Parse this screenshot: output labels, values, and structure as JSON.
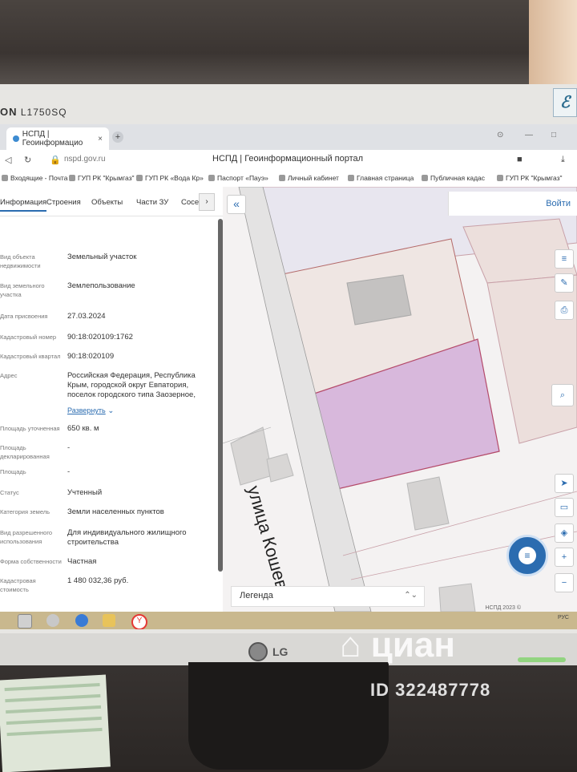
{
  "monitor": {
    "model_top": "L1750SQ",
    "brand_prefix": "ON",
    "bottom_brand": "LG"
  },
  "browser": {
    "tab_title": "НСПД | Геоинформацио",
    "tab_close": "×",
    "new_tab": "+",
    "url": "nspd.gov.ru",
    "page_title": "НСПД | Геоинформационный портал",
    "bookmarks": [
      "Входящие - Почта",
      "ГУП РК \"Крымгаз\"",
      "ГУП РК «Вода Кр»",
      "Паспорт «Пауэ»",
      "Личный кабинет",
      "Главная страница",
      "Публичная кадас",
      "ГУП РК \"Крымгаз\""
    ]
  },
  "panel": {
    "tabs": [
      "Информация",
      "Строения",
      "Объекты",
      "Части ЗУ",
      "Сосе"
    ],
    "rows": [
      {
        "label": "Вид объекта недвижимости",
        "value": "Земельный участок"
      },
      {
        "label": "Вид земельного участка",
        "value": "Землепользование"
      },
      {
        "label": "Дата присвоения",
        "value": "27.03.2024"
      },
      {
        "label": "Кадастровый номер",
        "value": "90:18:020109:1762"
      },
      {
        "label": "Кадастровый квартал",
        "value": "90:18:020109"
      },
      {
        "label": "Адрес",
        "value": "Российская Федерация, Республика Крым, городской округ Евпатория, поселок городского типа Заозерное,"
      },
      {
        "label": "Площадь уточненная",
        "value": "650 кв. м"
      },
      {
        "label": "Площадь декларированная",
        "value": "-"
      },
      {
        "label": "Площадь",
        "value": "-"
      },
      {
        "label": "Статус",
        "value": "Учтенный"
      },
      {
        "label": "Категория земель",
        "value": "Земли населенных пунктов"
      },
      {
        "label": "Вид разрешенного использования",
        "value": "Для индивидуального жилищного строительства"
      },
      {
        "label": "Форма собственности",
        "value": "Частная"
      },
      {
        "label": "Кадастровая стоимость",
        "value": "1 480 032,36 руб."
      }
    ],
    "expand_label": "Развернуть"
  },
  "map": {
    "street_label": "улица Кошево",
    "login_label": "Войти",
    "collapse_icon": "«",
    "legend_label": "Легенда",
    "legend_arrow": "⌃⌄",
    "footer": "НСПД 2023 ©",
    "colors": {
      "parcel_selected": "#d8b8dc",
      "parcel_border": "#b44a6a",
      "building": "#bdbdbd",
      "road": "#e6e6e6"
    }
  },
  "taskbar": {
    "tray_text": "РУС"
  },
  "watermark": {
    "logo": "⌂ циан",
    "id": "ID 322487778"
  }
}
